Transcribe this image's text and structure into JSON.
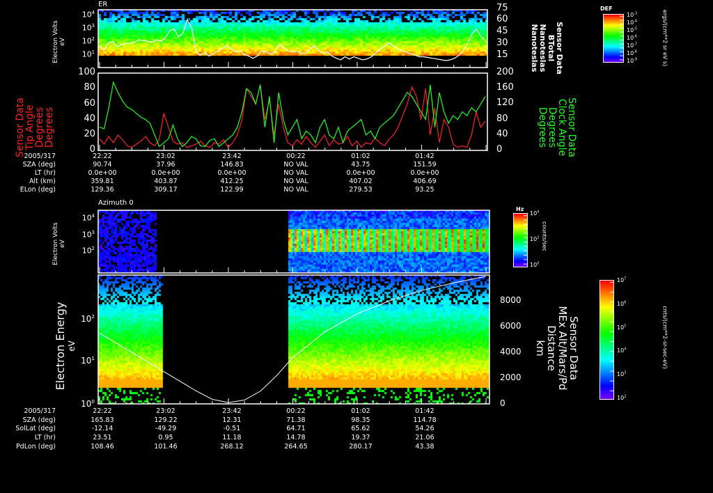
{
  "chart_data": [
    {
      "type": "heatmap",
      "title": "ER",
      "ylabel": "Electron Volts",
      "yunit": "eV",
      "yscale": "log",
      "yticks": [
        "10^1",
        "10^2",
        "10^3",
        "10^4"
      ],
      "right_axis": {
        "label_lines": [
          "Sensor Data",
          "BTotal",
          "Nanoteslas",
          "Nanoteslas"
        ],
        "ticks": [
          "15",
          "30",
          "45",
          "60",
          "75"
        ],
        "range": [
          0,
          75
        ]
      },
      "colorbar": {
        "title": "DEF",
        "ticks": [
          "10^-3",
          "10^-4",
          "10^-5",
          "10^-6",
          "10^-7",
          "10^-8",
          "10^-9"
        ],
        "unit": "ergs/(cm**2 sr eV s)"
      },
      "btotal_series": {
        "name": "BTotal",
        "color": "#ffffff",
        "values": [
          28,
          22,
          32,
          34,
          27,
          30,
          31,
          32,
          33,
          36,
          35,
          34,
          33,
          36,
          34,
          38,
          48,
          50,
          40,
          44,
          62,
          52,
          20,
          16,
          19,
          15,
          18,
          22,
          25,
          28,
          24,
          20,
          22,
          17,
          15,
          12,
          15,
          22,
          20,
          18,
          20,
          30,
          26,
          22,
          20,
          22,
          18,
          19,
          24,
          28,
          22,
          18,
          20,
          15,
          12,
          10,
          14,
          11,
          14,
          12,
          10,
          11,
          14,
          19,
          24,
          28,
          32,
          28,
          24,
          22,
          20,
          18,
          16,
          14,
          14,
          13,
          12,
          11,
          10,
          9,
          10,
          12,
          16,
          22,
          32,
          44,
          50,
          40,
          34
        ]
      }
    },
    {
      "type": "line",
      "ylabel_left_lines": [
        "Sensor Data",
        "Tip Angle",
        "Degrees",
        "Degrees"
      ],
      "ylabel_right_lines": [
        "Sensor Data",
        "Clock Angle",
        "Degrees",
        "Degrees"
      ],
      "ylim_left": [
        0,
        100
      ],
      "ylim_right": [
        0,
        200
      ],
      "yticks_left": [
        "0",
        "20",
        "40",
        "60",
        "80",
        "100"
      ],
      "yticks_right": [
        "0",
        "40",
        "80",
        "120",
        "160",
        "200"
      ],
      "series": [
        {
          "name": "Tip Angle",
          "axis": "left",
          "color": "#ff2020",
          "values": [
            15,
            8,
            18,
            10,
            20,
            14,
            6,
            4,
            8,
            12,
            18,
            10,
            6,
            14,
            48,
            30,
            12,
            8,
            10,
            4,
            6,
            8,
            12,
            6,
            4,
            10,
            8,
            14,
            4,
            10,
            20,
            40,
            80,
            70,
            60,
            85,
            40,
            65,
            20,
            60,
            30,
            10,
            6,
            14,
            8,
            18,
            10,
            4,
            12,
            20,
            6,
            14,
            8,
            10,
            18,
            6,
            12,
            4,
            10,
            8,
            16,
            10,
            6,
            14,
            20,
            30,
            45,
            60,
            82,
            70,
            40,
            80,
            20,
            55,
            10,
            40,
            30,
            8,
            4,
            6,
            4,
            20,
            50,
            30,
            38
          ]
        },
        {
          "name": "Clock Angle",
          "axis": "right",
          "color": "#20ff20",
          "values": [
            60,
            56,
            110,
            176,
            150,
            128,
            112,
            106,
            96,
            86,
            80,
            70,
            40,
            10,
            20,
            30,
            66,
            30,
            10,
            20,
            36,
            30,
            12,
            10,
            26,
            30,
            10,
            20,
            30,
            40,
            60,
            100,
            160,
            150,
            120,
            170,
            60,
            140,
            20,
            150,
            80,
            40,
            60,
            80,
            30,
            50,
            40,
            20,
            60,
            80,
            40,
            30,
            60,
            20,
            50,
            60,
            70,
            80,
            40,
            50,
            30,
            60,
            70,
            80,
            90,
            110,
            130,
            150,
            140,
            120,
            100,
            80,
            170,
            60,
            150,
            100,
            70,
            90,
            80,
            100,
            90,
            110,
            100,
            120,
            140
          ]
        }
      ]
    },
    {
      "type": "heatmap",
      "title": "Azimuth 0",
      "ylabel": "Electron Volts",
      "yunit": "eV",
      "yscale": "log",
      "yticks": [
        "10^2",
        "10^3",
        "10^4"
      ],
      "colorbar": {
        "title": "Hz",
        "ticks": [
          "10^4",
          "10^2",
          "10^0"
        ],
        "unit": "counts/sec"
      },
      "data_gap": [
        "22:57",
        "00:22"
      ]
    },
    {
      "type": "heatmap",
      "ylabel": "Electron Energy",
      "yunit": "eV",
      "yscale": "log",
      "yticks": [
        "10^0",
        "10^1",
        "10^2"
      ],
      "right_axis": {
        "label_lines": [
          "Sensor Data",
          "MEx Alt/Mars/Pd",
          "Distance",
          "km"
        ],
        "ticks": [
          "0",
          "2000",
          "4000",
          "6000",
          "8000"
        ],
        "range": [
          0,
          10000
        ]
      },
      "colorbar": {
        "ticks": [
          "10^7",
          "10^6",
          "10^5",
          "10^4",
          "10^3",
          "10^2"
        ],
        "unit": "cnts/(cm**2-sr-sec-eV)"
      },
      "data_gap": [
        "23:02",
        "00:22"
      ],
      "distance_series": {
        "name": "MEx Alt",
        "color": "#ffffff",
        "times_min": [
          0,
          20,
          40,
          60,
          70,
          80,
          90,
          100,
          110,
          120,
          140,
          160,
          180,
          200,
          220,
          240
        ],
        "values": [
          5500,
          4000,
          2500,
          1000,
          350,
          100,
          300,
          1000,
          2200,
          3600,
          5600,
          7000,
          8000,
          8800,
          9400,
          9900
        ]
      }
    }
  ],
  "top_table": {
    "header": "2005/317",
    "times": [
      "22:22",
      "23:02",
      "23:42",
      "00:22",
      "01:02",
      "01:42"
    ],
    "rows": [
      {
        "label": "SZA (deg)",
        "values": [
          "90.74",
          "37.96",
          "146.83",
          "NO VAL",
          "43.75",
          "151.59"
        ]
      },
      {
        "label": "LT (hr)",
        "values": [
          "0.0e+00",
          "0.0e+00",
          "0.0e+00",
          "NO VAL",
          "0.0e+00",
          "0.0e+00"
        ]
      },
      {
        "label": "Alt (km)",
        "values": [
          "359.81",
          "403.87",
          "412.25",
          "NO VAL",
          "407.02",
          "406.69"
        ]
      },
      {
        "label": "ELon (deg)",
        "values": [
          "129.36",
          "309.17",
          "122.99",
          "NO VAL",
          "279.53",
          "93.25"
        ]
      }
    ]
  },
  "bottom_table": {
    "header": "2005/317",
    "times": [
      "22:22",
      "23:02",
      "23:42",
      "00:22",
      "01:02",
      "01:42"
    ],
    "rows": [
      {
        "label": "SZA (deg)",
        "values": [
          "165.83",
          "129.22",
          "12.31",
          "71.38",
          "98.35",
          "114.78"
        ]
      },
      {
        "label": "SolLat (deg)",
        "values": [
          "-12.14",
          "-49.29",
          "-0.51",
          "64.71",
          "65.62",
          "54.26"
        ]
      },
      {
        "label": "LT (hr)",
        "values": [
          "23.51",
          "0.95",
          "11.18",
          "14.78",
          "19.37",
          "21.06"
        ]
      },
      {
        "label": "PdLon (deg)",
        "values": [
          "108.46",
          "101.46",
          "268.12",
          "264.65",
          "280.17",
          "43.38"
        ]
      }
    ]
  }
}
